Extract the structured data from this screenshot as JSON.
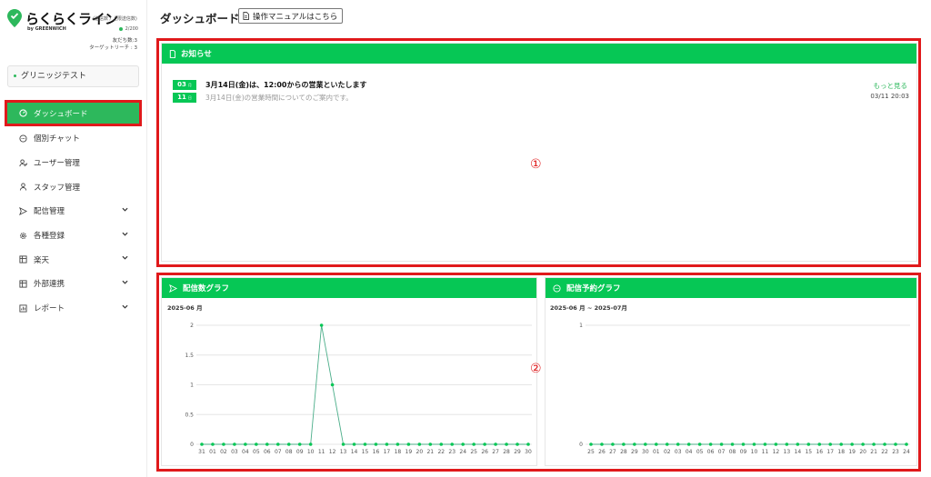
{
  "brand": {
    "name": "らくらくライン",
    "by": "by GREENWICH",
    "sub": "(送信数 / 上限送信数)",
    "count": "2/200",
    "friends": "友だち数:3",
    "target_reach": "ターゲットリーチ : 3"
  },
  "account": {
    "name": "グリニッジテスト"
  },
  "nav": {
    "items": [
      {
        "label": "ダッシュボード",
        "icon": "dashboard-icon",
        "active": true
      },
      {
        "label": "個別チャット",
        "icon": "chat-icon"
      },
      {
        "label": "ユーザー管理",
        "icon": "users-icon"
      },
      {
        "label": "スタッフ管理",
        "icon": "staff-icon"
      },
      {
        "label": "配信管理",
        "icon": "send-icon",
        "expandable": true
      },
      {
        "label": "各種登録",
        "icon": "gear-icon",
        "expandable": true
      },
      {
        "label": "楽天",
        "icon": "shop-icon",
        "expandable": true
      },
      {
        "label": "外部連携",
        "icon": "link-icon",
        "expandable": true
      },
      {
        "label": "レポート",
        "icon": "report-icon",
        "expandable": true
      }
    ]
  },
  "header": {
    "title": "ダッシュボード",
    "manual_button": "操作マニュアルはこちら"
  },
  "notice": {
    "title": "お知らせ",
    "more": "もっと見る",
    "items": [
      {
        "month": "03",
        "month_unit": "月",
        "day": "11",
        "day_unit": "日",
        "headline": "3月14日(金)は、12:00からの営業といたします",
        "description": "3月14日(金)の営業時間についてのご案内です。",
        "timestamp": "03/11 20:03"
      }
    ]
  },
  "markers": {
    "one": "①",
    "two": "②"
  },
  "colors": {
    "brand": "#06c755",
    "highlight": "#e0191b",
    "line": "#4cae8a"
  },
  "chart_data": [
    {
      "type": "line",
      "title": "配信数グラフ",
      "subtitle": "2025-06 月",
      "categories": [
        "31",
        "01",
        "02",
        "03",
        "04",
        "05",
        "06",
        "07",
        "08",
        "09",
        "10",
        "11",
        "12",
        "13",
        "14",
        "15",
        "16",
        "17",
        "18",
        "19",
        "20",
        "21",
        "22",
        "23",
        "24",
        "25",
        "26",
        "27",
        "28",
        "29",
        "30"
      ],
      "series": [
        {
          "values": [
            0,
            0,
            0,
            0,
            0,
            0,
            0,
            0,
            0,
            0,
            0,
            2,
            1,
            0,
            0,
            0,
            0,
            0,
            0,
            0,
            0,
            0,
            0,
            0,
            0,
            0,
            0,
            0,
            0,
            0,
            0
          ]
        }
      ],
      "yticks": [
        "0",
        "0.5",
        "1",
        "1.5",
        "2"
      ],
      "ylim": [
        0,
        2
      ],
      "grid": true
    },
    {
      "type": "line",
      "title": "配信予約グラフ",
      "subtitle": "2025-06 月 ~ 2025-07月",
      "categories": [
        "25",
        "26",
        "27",
        "28",
        "29",
        "30",
        "01",
        "02",
        "03",
        "04",
        "05",
        "06",
        "07",
        "08",
        "09",
        "10",
        "11",
        "12",
        "13",
        "14",
        "15",
        "16",
        "17",
        "18",
        "19",
        "20",
        "21",
        "22",
        "23",
        "24"
      ],
      "series": [
        {
          "values": [
            0,
            0,
            0,
            0,
            0,
            0,
            0,
            0,
            0,
            0,
            0,
            0,
            0,
            0,
            0,
            0,
            0,
            0,
            0,
            0,
            0,
            0,
            0,
            0,
            0,
            0,
            0,
            0,
            0,
            0
          ]
        }
      ],
      "yticks": [
        "0",
        "1"
      ],
      "ylim": [
        0,
        1
      ],
      "grid": true
    }
  ]
}
